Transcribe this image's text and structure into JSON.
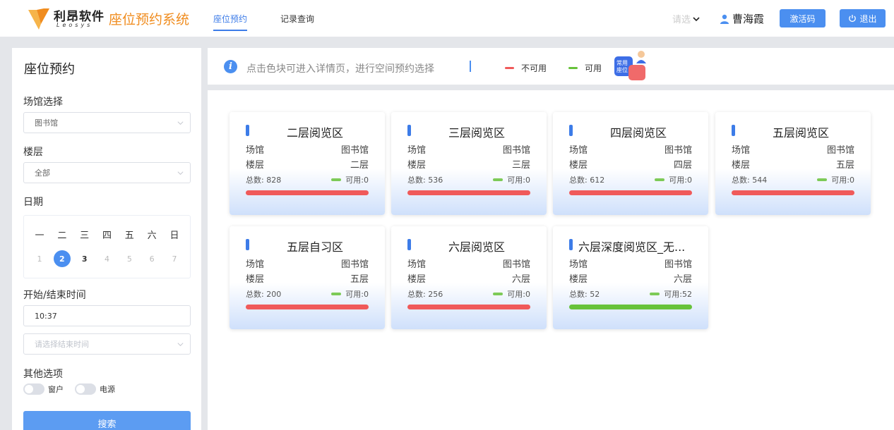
{
  "header": {
    "brand_name": "利昂软件",
    "brand_sub": "Leosys",
    "app_title": "座位预约系统",
    "nav": [
      {
        "label": "座位预约",
        "active": true
      },
      {
        "label": "记录查询",
        "active": false
      }
    ],
    "select_hint": "请选",
    "user_name": "曹海霞",
    "activate_label": "激活码",
    "logout_label": "退出"
  },
  "sidebar": {
    "title": "座位预约",
    "venue_label": "场馆选择",
    "venue_value": "图书馆",
    "floor_label": "楼层",
    "floor_value": "全部",
    "date_label": "日期",
    "weekdays": [
      "一",
      "二",
      "三",
      "四",
      "五",
      "六",
      "日"
    ],
    "days": [
      "1",
      "2",
      "3",
      "4",
      "5",
      "6",
      "7"
    ],
    "selected_day": "2",
    "time_label": "开始/结束时间",
    "start_time": "10:37",
    "end_time_placeholder": "请选择结束时间",
    "options_label": "其他选项",
    "option_window": "窗户",
    "option_power": "电源",
    "search_label": "搜索"
  },
  "infobar": {
    "text": "点击色块可进入详情页，进行空间预约选择",
    "legend_unavailable": "不可用",
    "legend_available": "可用",
    "mascot_text_1": "常用",
    "mascot_text_2": "座位"
  },
  "labels": {
    "venue": "场馆",
    "floor": "楼层",
    "total_prefix": "总数: ",
    "avail_prefix": "可用: "
  },
  "colors": {
    "accent": "#3d7ce8",
    "unavailable": "#f05a5a",
    "available": "#67c23a",
    "title_orange": "#f08c1e"
  },
  "areas": [
    {
      "name": "二层阅览区",
      "venue": "图书馆",
      "floor": "二层",
      "total": "828",
      "available": "0",
      "status": "unavailable"
    },
    {
      "name": "三层阅览区",
      "venue": "图书馆",
      "floor": "三层",
      "total": "536",
      "available": "0",
      "status": "unavailable"
    },
    {
      "name": "四层阅览区",
      "venue": "图书馆",
      "floor": "四层",
      "total": "612",
      "available": "0",
      "status": "unavailable"
    },
    {
      "name": "五层阅览区",
      "venue": "图书馆",
      "floor": "五层",
      "total": "544",
      "available": "0",
      "status": "unavailable"
    },
    {
      "name": "五层自习区",
      "venue": "图书馆",
      "floor": "五层",
      "total": "200",
      "available": "0",
      "status": "unavailable"
    },
    {
      "name": "六层阅览区",
      "venue": "图书馆",
      "floor": "六层",
      "total": "256",
      "available": "0",
      "status": "unavailable"
    },
    {
      "name": "六层深度阅览区_无...",
      "venue": "图书馆",
      "floor": "六层",
      "total": "52",
      "available": "52",
      "status": "available"
    }
  ]
}
